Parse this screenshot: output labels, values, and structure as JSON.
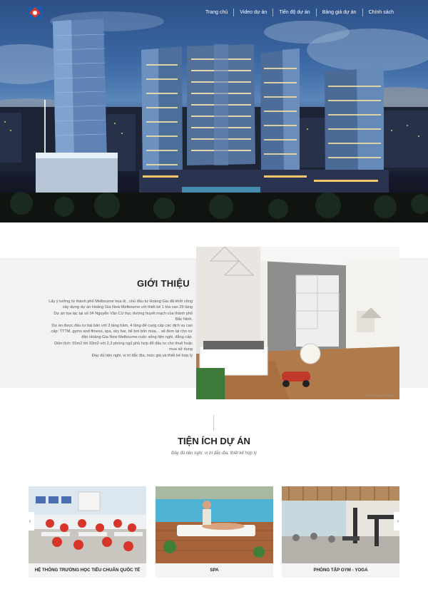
{
  "header": {
    "logo_icon": "building-logo-icon",
    "nav": [
      {
        "label": "Trang chủ"
      },
      {
        "label": "Video dự án"
      },
      {
        "label": "Tiến độ dự án"
      },
      {
        "label": "Bảng giá dự án"
      },
      {
        "label": "Chính sách"
      }
    ]
  },
  "intro": {
    "title": "GIỚI THIỆU",
    "paragraph_lines": [
      "Lấy ý tưởng từ thành phố Melbourne hoa lệ , chủ đầu tư Hoàng Gia đã khởi công",
      "xây dựng dự án Hoàng Gia New Melbourne với thiết kế 1 tòa cao 29 tầng",
      "Dự án tọa lạc tại số 34 Nguyễn Văn Cừ trục đường huyết mạch của thành phố",
      "Bắc Ninh.",
      "Dự án được đầu tư bài bản với 3 tầng hầm, 4 tầng đế cung cấp các dịch vụ cao",
      "cấp: TTTM, gyms and fitness, spa, sky bar, bể bơi bốn mùa… sẽ đem lại cho cư",
      "dân Hoàng Gia New Melbourne cuộc sống tiện nghi, đẳng cấp.",
      "Diện tích: 55m2 tới 93m2 với 2,3 phòng ngủ phù hợp để đầu tư cho thuê hoặc",
      "mua sử dụng",
      "Đầy đủ tiện nghi, vị trí đắc địa, mức giá và thiết kế hợp lý"
    ],
    "image_caption": "© SPACE DESIGN STUDIO"
  },
  "amenities": {
    "title": "TIỆN ÍCH DỰ ÁN",
    "subtitle": "Đầy đủ tiện nghi, vị trí đắc địa, thiết kế hợp lý",
    "cards": [
      {
        "label": "HỆ THỐNG TRƯỜNG HỌC TIÊU CHUẨN QUỐC TẾ"
      },
      {
        "label": "SPA"
      },
      {
        "label": "PHÒNG TẬP GYM - YOGA"
      }
    ],
    "prev_arrow": "‹",
    "next_arrow": "›"
  }
}
